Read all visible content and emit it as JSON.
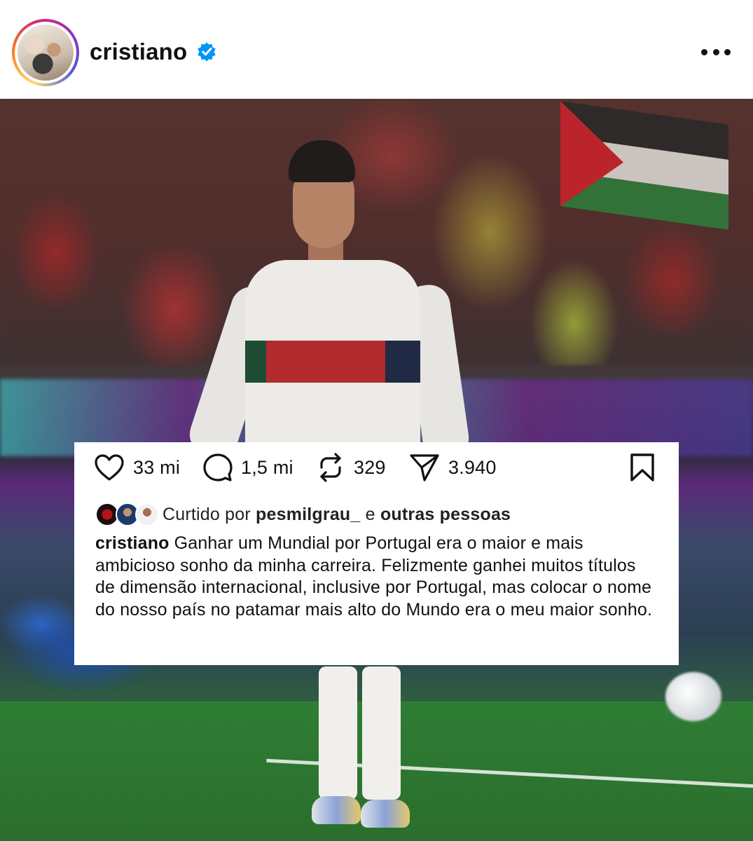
{
  "post": {
    "username": "cristiano",
    "verified": true,
    "more_icon": "more-horizontal-icon"
  },
  "actions": {
    "likes": "33 mi",
    "comments": "1,5 mi",
    "reposts": "329",
    "shares": "3.940"
  },
  "liked_by": {
    "prefix": "Curtido por",
    "user": "pesmilgrau_",
    "connector": "e",
    "others": "outras pessoas"
  },
  "caption": {
    "user": "cristiano",
    "text": "Ganhar um Mundial por Portugal era o maior e mais ambicioso sonho da minha carreira. Felizmente ganhei muitos títulos de dimensão internacional, inclusive por Portugal, mas colocar o nome do nosso país no patamar mais alto do Mundo era o meu maior sonho."
  },
  "colors": {
    "verified_blue": "#0095f6",
    "text": "#111111"
  }
}
